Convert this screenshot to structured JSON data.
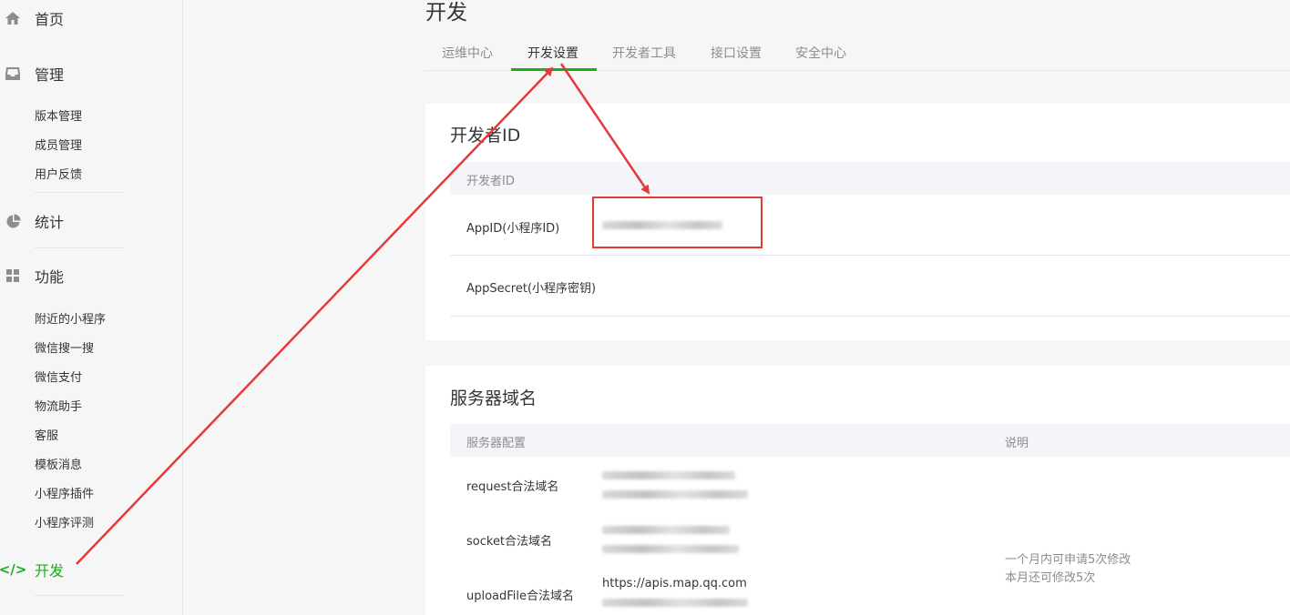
{
  "sidebar": {
    "home": "首页",
    "manage": {
      "label": "管理",
      "items": [
        "版本管理",
        "成员管理",
        "用户反馈"
      ]
    },
    "stats": "统计",
    "features": {
      "label": "功能",
      "items": [
        "附近的小程序",
        "微信搜一搜",
        "微信支付",
        "物流助手",
        "客服",
        "模板消息",
        "小程序插件",
        "小程序评测"
      ]
    },
    "dev": {
      "label": "开发",
      "icon_text": "</>"
    }
  },
  "page_title": "开发",
  "tabs": [
    "运维中心",
    "开发设置",
    "开发者工具",
    "接口设置",
    "安全中心"
  ],
  "active_tab": "开发设置",
  "developer_id": {
    "title": "开发者ID",
    "header": "开发者ID",
    "rows": [
      {
        "label": "AppID(小程序ID)"
      },
      {
        "label": "AppSecret(小程序密钥)"
      }
    ]
  },
  "server_domain": {
    "title": "服务器域名",
    "header_config": "服务器配置",
    "header_note": "说明",
    "rows": [
      {
        "label": "request合法域名"
      },
      {
        "label": "socket合法域名"
      },
      {
        "label": "uploadFile合法域名",
        "value": "https://apis.map.qq.com"
      }
    ],
    "notes": [
      "一个月内可申请5次修改",
      "本月还可修改5次"
    ]
  },
  "colors": {
    "accent": "#1aad19",
    "annotation": "#e53a3a"
  }
}
